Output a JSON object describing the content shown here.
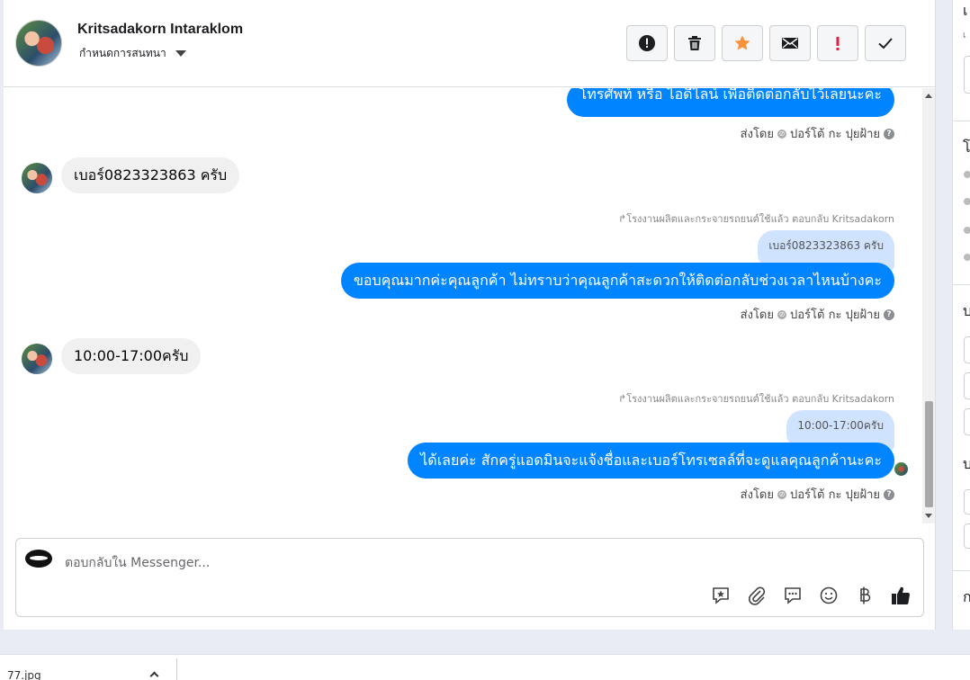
{
  "header": {
    "contact_name": "Kritsadakorn Intaraklom",
    "assign_label": "กำหนดการสนทนา",
    "actions": [
      {
        "name": "report-button",
        "icon": "alert-circle-icon"
      },
      {
        "name": "delete-button",
        "icon": "trash-icon"
      },
      {
        "name": "star-button",
        "icon": "star-icon"
      },
      {
        "name": "mark-unread-button",
        "icon": "envelope-icon"
      },
      {
        "name": "spam-button",
        "icon": "exclamation-icon"
      },
      {
        "name": "mark-done-button",
        "icon": "check-icon"
      }
    ]
  },
  "colors": {
    "outgoing_bubble": "#0084ff",
    "incoming_bubble": "#f0f0f0",
    "quote_bubble": "#cfe3ff",
    "star": "#f7923a",
    "spam": "#e41e3f"
  },
  "messages": {
    "m1_out": "โทรศัพท์ หรือ ไอดีไลน์ เพื่อติดต่อกลับไว้เลยนะคะ",
    "m1_sent_by_prefix": "ส่งโดย",
    "m1_sent_by_name": "ปอร์โต้ กะ ปุยฝ้าย",
    "m2_in": "เบอร์0823323863 ครับ",
    "m3_reply_note": "โรงงานผลิตและกระจายรถยนต์ใช้แล้ว ตอบกลับ Kritsadakorn",
    "m3_quote": "เบอร์0823323863 ครับ",
    "m3_out": "ขอบคุณมากค่ะคุณลูกค้า ไม่ทราบว่าคุณลูกค้าสะดวกให้ติดต่อกลับช่วงเวลาไหนบ้างคะ",
    "m3_sent_by_prefix": "ส่งโดย",
    "m3_sent_by_name": "ปอร์โต้ กะ ปุยฝ้าย",
    "m4_in": "10:00-17:00ครับ",
    "m5_reply_note": "โรงงานผลิตและกระจายรถยนต์ใช้แล้ว ตอบกลับ Kritsadakorn",
    "m5_quote": "10:00-17:00ครับ",
    "m5_out": "ได้เลยค่ะ สักครู่แอดมินจะแจ้งชื่อและเบอร์โทรเซลล์ที่จะดูแลคุณลูกค้านะคะ",
    "m5_sent_by_prefix": "ส่งโดย",
    "m5_sent_by_name": "ปอร์โต้ กะ ปุยฝ้าย"
  },
  "composer": {
    "placeholder": "ตอบกลับใน Messenger...",
    "tools": [
      "saved-reply-icon",
      "attachment-icon",
      "chat-icon",
      "emoji-icon",
      "baht-icon",
      "like-icon"
    ]
  },
  "download_bar": {
    "file_name": "77.jpg"
  }
}
